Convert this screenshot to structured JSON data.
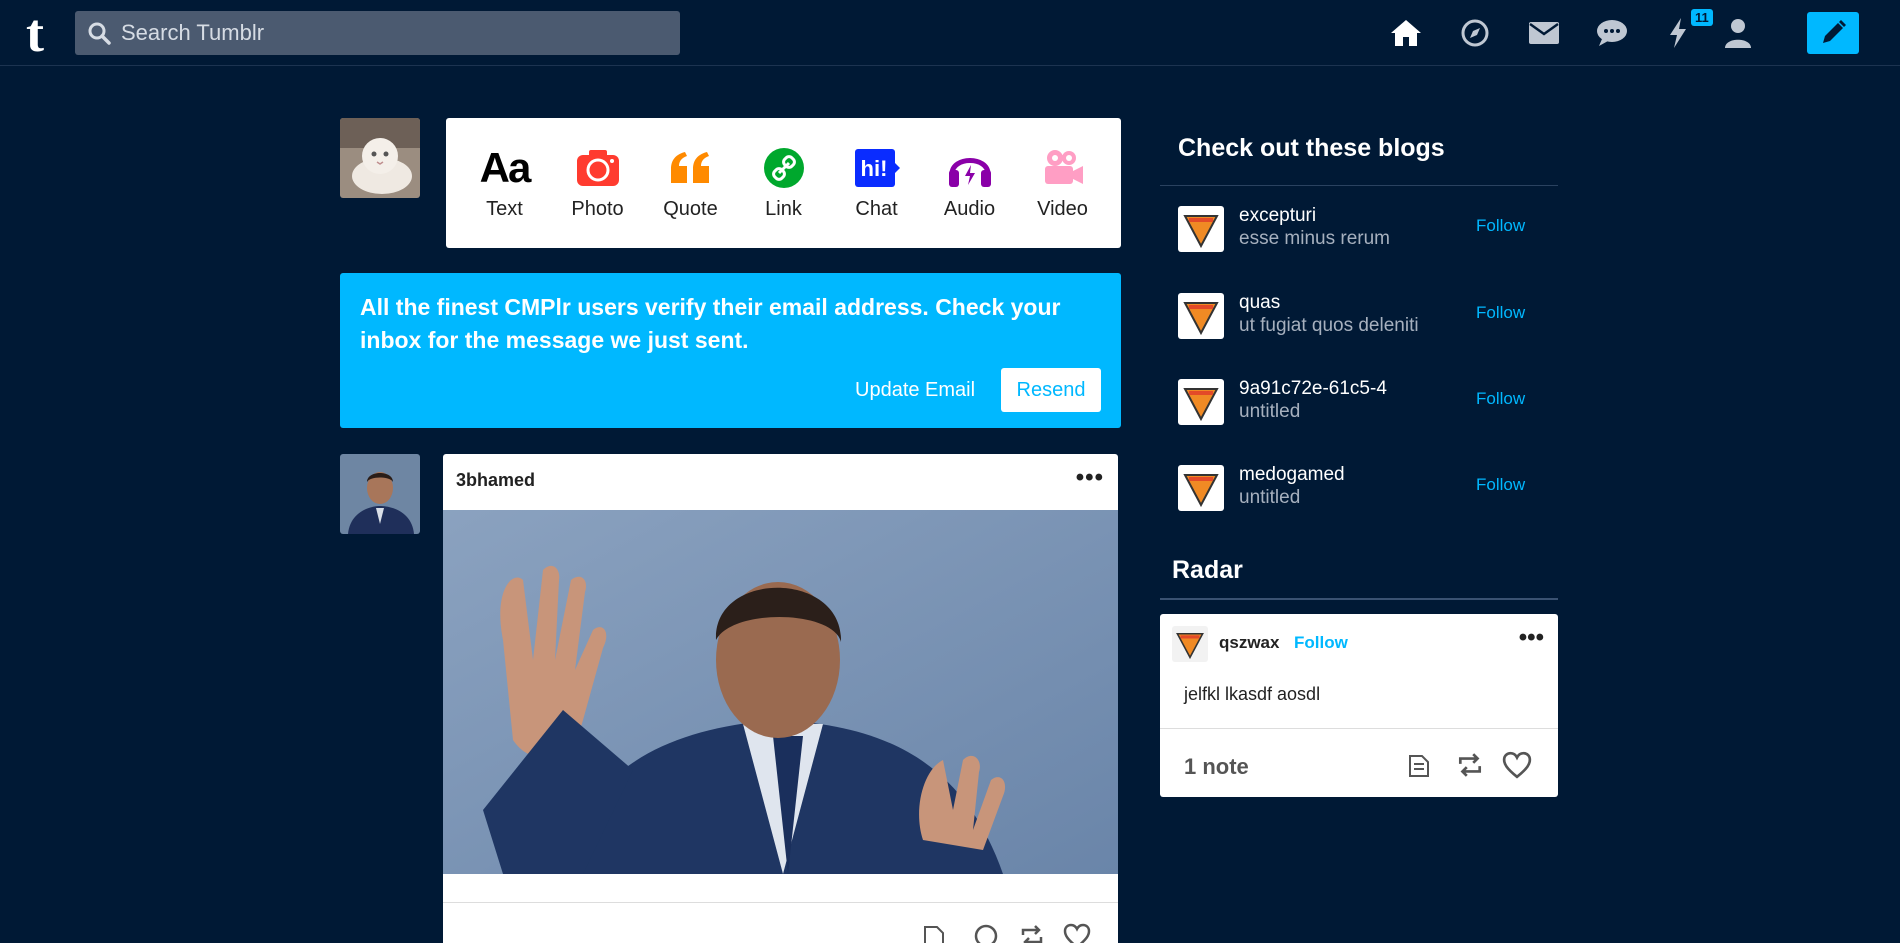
{
  "topbar": {
    "logo": "t",
    "search_placeholder": "Search Tumblr",
    "activity_badge": "11",
    "icons": [
      "home-icon",
      "explore-icon",
      "inbox-icon",
      "messages-icon",
      "activity-icon",
      "account-icon",
      "compose-icon"
    ]
  },
  "post_types": [
    {
      "label": "Text",
      "icon": "text-icon",
      "color": "#000000"
    },
    {
      "label": "Photo",
      "icon": "camera-icon",
      "color": "#ff492f"
    },
    {
      "label": "Quote",
      "icon": "quote-icon",
      "color": "#ff8a00"
    },
    {
      "label": "Link",
      "icon": "link-icon",
      "color": "#00cf35"
    },
    {
      "label": "Chat",
      "icon": "chat-icon",
      "color": "#00b8ff"
    },
    {
      "label": "Audio",
      "icon": "headphones-icon",
      "color": "#7c5cff"
    },
    {
      "label": "Video",
      "icon": "video-camera-icon",
      "color": "#ff62ce"
    }
  ],
  "verify": {
    "message": "All the finest CMPlr users verify their email address. Check your inbox for the message we just sent.",
    "update_label": "Update Email",
    "resend_label": "Resend"
  },
  "post": {
    "poster": "3bhamed",
    "more": "•••"
  },
  "sidebar": {
    "title": "Check out these blogs",
    "follow_label": "Follow",
    "blogs": [
      {
        "name": "excepturi",
        "subtitle": "esse minus rerum"
      },
      {
        "name": "quas",
        "subtitle": "ut fugiat quos deleniti"
      },
      {
        "name": "9a91c72e-61c5-4",
        "subtitle": "untitled"
      },
      {
        "name": "medogamed",
        "subtitle": "untitled"
      }
    ],
    "radar_title": "Radar",
    "radar": {
      "name": "qszwax",
      "follow_label": "Follow",
      "more": "•••",
      "body": "jelfkl lkasdf aosdl",
      "notes": "1 note"
    }
  },
  "colors": {
    "background": "#001935",
    "accent": "#00b8ff"
  }
}
